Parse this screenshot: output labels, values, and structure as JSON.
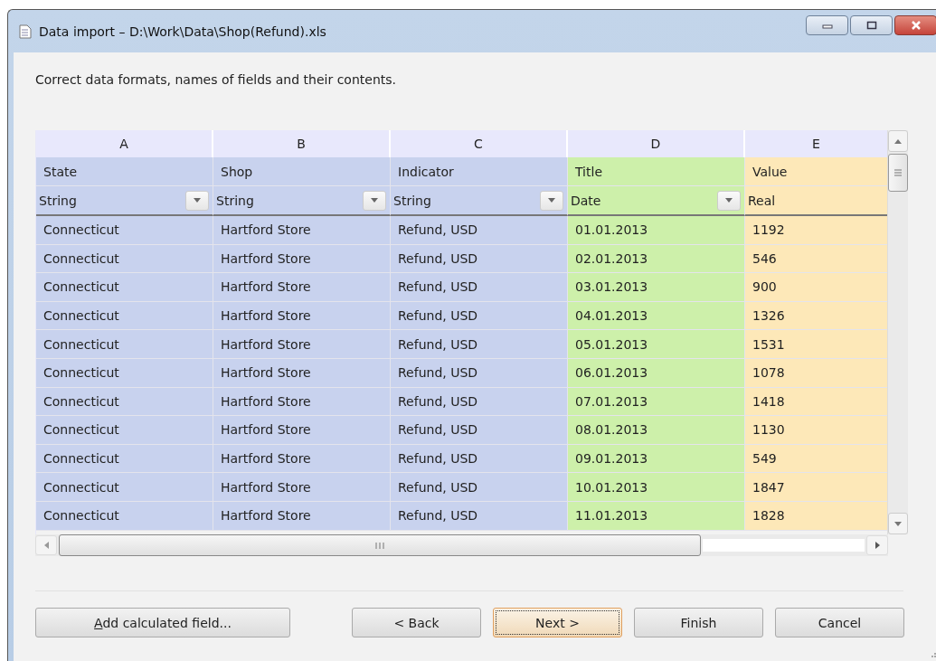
{
  "window": {
    "title": "Data import – D:\\Work\\Data\\Shop(Refund).xls"
  },
  "instruction": "Correct data formats, names of fields and their contents.",
  "grid": {
    "columns": [
      {
        "letter": "A",
        "name": "State",
        "type": "String",
        "dropdown": true,
        "color": "#c8d2ee"
      },
      {
        "letter": "B",
        "name": "Shop",
        "type": "String",
        "dropdown": true,
        "color": "#c8d2ee"
      },
      {
        "letter": "C",
        "name": "Indicator",
        "type": "String",
        "dropdown": true,
        "color": "#c8d2ee"
      },
      {
        "letter": "D",
        "name": "Title",
        "type": "Date",
        "dropdown": true,
        "color": "#cdf0aa"
      },
      {
        "letter": "E",
        "name": "Value",
        "type": "Real",
        "dropdown": false,
        "color": "#fde8b8"
      }
    ],
    "rows": [
      [
        "Connecticut",
        "Hartford Store",
        "Refund, USD",
        "01.01.2013",
        "1192"
      ],
      [
        "Connecticut",
        "Hartford Store",
        "Refund, USD",
        "02.01.2013",
        "546"
      ],
      [
        "Connecticut",
        "Hartford Store",
        "Refund, USD",
        "03.01.2013",
        "900"
      ],
      [
        "Connecticut",
        "Hartford Store",
        "Refund, USD",
        "04.01.2013",
        "1326"
      ],
      [
        "Connecticut",
        "Hartford Store",
        "Refund, USD",
        "05.01.2013",
        "1531"
      ],
      [
        "Connecticut",
        "Hartford Store",
        "Refund, USD",
        "06.01.2013",
        "1078"
      ],
      [
        "Connecticut",
        "Hartford Store",
        "Refund, USD",
        "07.01.2013",
        "1418"
      ],
      [
        "Connecticut",
        "Hartford Store",
        "Refund, USD",
        "08.01.2013",
        "1130"
      ],
      [
        "Connecticut",
        "Hartford Store",
        "Refund, USD",
        "09.01.2013",
        "549"
      ],
      [
        "Connecticut",
        "Hartford Store",
        "Refund, USD",
        "10.01.2013",
        "1847"
      ],
      [
        "Connecticut",
        "Hartford Store",
        "Refund, USD",
        "11.01.2013",
        "1828"
      ]
    ]
  },
  "add_button": "Add calculated field...",
  "buttons": [
    {
      "label": "< Back",
      "default": false
    },
    {
      "label": "Next >",
      "default": true
    },
    {
      "label": "Finish",
      "default": false
    },
    {
      "label": "Cancel",
      "default": false
    }
  ]
}
